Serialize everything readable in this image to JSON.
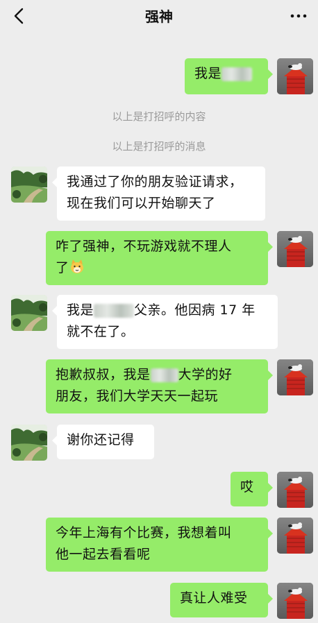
{
  "header": {
    "title": "强神"
  },
  "system_messages": [
    "以上是打招呼的内容",
    "以上是打招呼的消息"
  ],
  "messages": [
    {
      "side": "sent",
      "text": "我是",
      "redacted": true
    },
    {
      "side": "recv",
      "text": "我通过了你的朋友验证请求，现在我们可以开始聊天了"
    },
    {
      "side": "sent",
      "line1": "咋了强神，不玩游戏就不理人",
      "line2": "了",
      "emoji": "cat-face-emoji"
    },
    {
      "side": "recv",
      "pre": "我是",
      "post": "父亲。他因病 17 年",
      "line2": "就不在了。"
    },
    {
      "side": "sent",
      "pre": "抱歉叔叔，我是",
      "post": "大学的好",
      "line2": "朋友，我们大学天天一起玩"
    },
    {
      "side": "recv",
      "text": "谢你还记得"
    },
    {
      "side": "sent",
      "text": "哎"
    },
    {
      "side": "sent",
      "line1": "今年上海有个比赛，我想着叫",
      "line2": "他一起去看看呢"
    },
    {
      "side": "sent",
      "text": "真让人难受"
    }
  ],
  "avatars": {
    "me": "snoopy-doghouse-avatar",
    "contact": "garden-landscape-avatar"
  },
  "colors": {
    "sent_bubble": "#95ec69",
    "recv_bubble": "#ffffff",
    "background": "#ededed"
  }
}
